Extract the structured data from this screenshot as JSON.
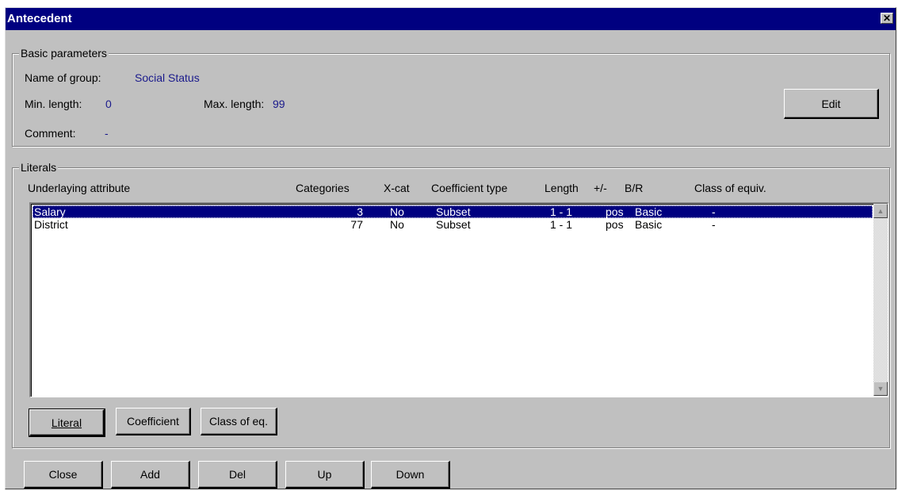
{
  "window": {
    "title": "Antecedent",
    "close_glyph": "✕"
  },
  "basic": {
    "legend": "Basic parameters",
    "name_label": "Name of group:",
    "name_value": "Social Status",
    "min_label": "Min. length:",
    "min_value": "0",
    "max_label": "Max. length:",
    "max_value": "99",
    "comment_label": "Comment:",
    "comment_value": "-",
    "edit_button": "Edit"
  },
  "literals": {
    "legend": "Literals",
    "columns": [
      "Underlaying attribute",
      "Categories",
      "X-cat",
      "Coefficient type",
      "Length",
      "+/-",
      "B/R",
      "Class of equiv."
    ],
    "rows": [
      {
        "attribute": "Salary",
        "categories": "3",
        "xcat": "No",
        "coef": "Subset",
        "length": "1 - 1",
        "sign": "pos",
        "br": "Basic",
        "equiv": "-"
      },
      {
        "attribute": "District",
        "categories": "77",
        "xcat": "No",
        "coef": "Subset",
        "length": "1 - 1",
        "sign": "pos",
        "br": "Basic",
        "equiv": "-"
      }
    ],
    "buttons": {
      "literal": "Literal",
      "coefficient": "Coefficient",
      "class_eq": "Class of eq."
    }
  },
  "footer": {
    "close": "Close",
    "add": "Add",
    "del": "Del",
    "up": "Up",
    "down": "Down"
  },
  "icons": {
    "scroll_up": "scroll-up-icon",
    "scroll_down": "scroll-down-icon"
  },
  "colors": {
    "titlebar": "#000080",
    "value_text": "#1a1a8c",
    "selection": "#000080"
  }
}
